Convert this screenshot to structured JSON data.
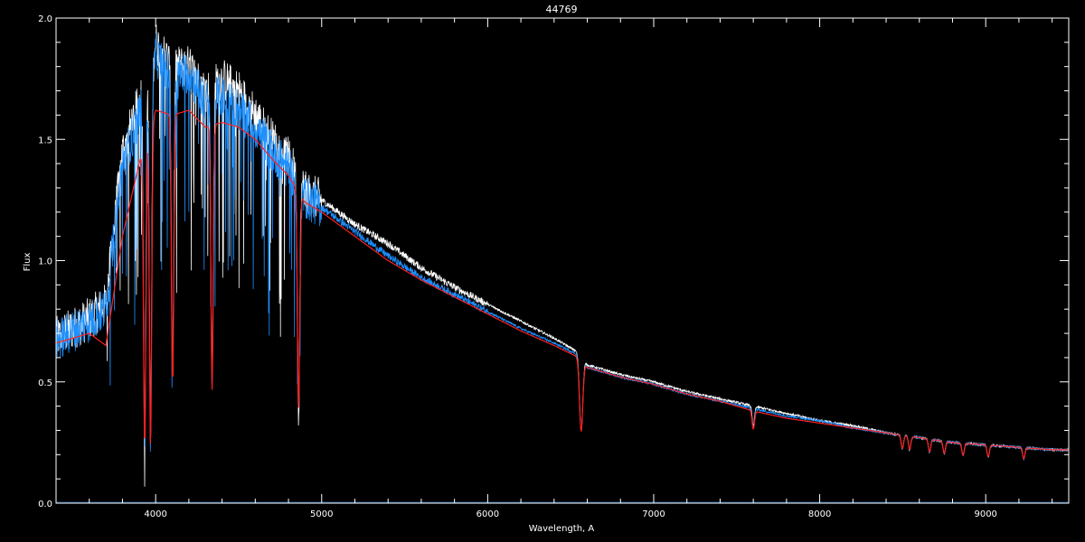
{
  "chart_data": {
    "type": "line",
    "title": "44769",
    "xlabel": "Wavelength, A",
    "ylabel": "Flux",
    "xlim": [
      3400,
      9500
    ],
    "ylim": [
      0.0,
      2.0
    ],
    "x_ticks": [
      4000,
      5000,
      6000,
      7000,
      8000,
      9000
    ],
    "x_tick_labels": [
      "4000",
      "5000",
      "6000",
      "7000",
      "8000",
      "9000"
    ],
    "y_ticks": [
      0.0,
      0.5,
      1.0,
      1.5,
      2.0
    ],
    "y_tick_labels": [
      "0.0",
      "0.5",
      "1.0",
      "1.5",
      "2.0"
    ],
    "grid": false,
    "colors": {
      "background": "#000000",
      "axes": "#ffffff",
      "observed": "#ffffff",
      "model": "#1e90ff",
      "fit": "#ff2020"
    },
    "series": [
      {
        "key": "observed",
        "color": "#ffffff",
        "x": [
          3400,
          3600,
          3700,
          3800,
          3900,
          4000,
          4100,
          4200,
          4300,
          4400,
          4500,
          4600,
          4700,
          4800,
          4900,
          5000,
          5200,
          5400,
          5600,
          5800,
          6000,
          6200,
          6400,
          6550,
          6600,
          6800,
          7000,
          7200,
          7400,
          7600,
          7800,
          8000,
          8200,
          8400,
          8600,
          8800,
          9000,
          9200,
          9400,
          9500
        ],
        "y": [
          0.68,
          0.76,
          0.82,
          1.45,
          1.65,
          1.9,
          1.8,
          1.8,
          1.7,
          1.75,
          1.7,
          1.6,
          1.5,
          1.42,
          1.28,
          1.25,
          1.15,
          1.07,
          0.97,
          0.89,
          0.82,
          0.75,
          0.68,
          0.62,
          0.57,
          0.53,
          0.5,
          0.46,
          0.43,
          0.4,
          0.37,
          0.34,
          0.32,
          0.29,
          0.27,
          0.25,
          0.24,
          0.23,
          0.22,
          0.22
        ]
      },
      {
        "key": "model",
        "color": "#1e90ff",
        "x": [
          3400,
          3600,
          3700,
          3800,
          3900,
          4000,
          4100,
          4200,
          4300,
          4400,
          4500,
          4600,
          4700,
          4800,
          4900,
          5000,
          5200,
          5400,
          5600,
          5800,
          6000,
          6200,
          6400,
          6550,
          6600,
          6800,
          7000,
          7200,
          7400,
          7600,
          7800,
          8000,
          8200,
          8400,
          8600,
          8800,
          9000,
          9200,
          9400,
          9500
        ],
        "y": [
          0.67,
          0.75,
          0.8,
          1.4,
          1.6,
          1.85,
          1.75,
          1.78,
          1.65,
          1.68,
          1.62,
          1.55,
          1.45,
          1.38,
          1.26,
          1.22,
          1.12,
          1.02,
          0.93,
          0.86,
          0.79,
          0.72,
          0.66,
          0.61,
          0.56,
          0.52,
          0.49,
          0.45,
          0.42,
          0.39,
          0.36,
          0.34,
          0.31,
          0.29,
          0.27,
          0.25,
          0.24,
          0.23,
          0.22,
          0.22
        ]
      },
      {
        "key": "fit",
        "color": "#ff2020",
        "x": [
          3400,
          3600,
          3700,
          3800,
          3900,
          4000,
          4100,
          4200,
          4300,
          4400,
          4500,
          4600,
          4700,
          4800,
          4900,
          5000,
          5200,
          5400,
          5600,
          5800,
          6000,
          6200,
          6400,
          6550,
          6600,
          6800,
          7000,
          7200,
          7400,
          7600,
          7800,
          8000,
          8200,
          8400,
          8600,
          8800,
          9000,
          9200,
          9400,
          9500
        ],
        "y": [
          0.66,
          0.7,
          0.65,
          1.1,
          1.4,
          1.62,
          1.6,
          1.62,
          1.55,
          1.57,
          1.55,
          1.5,
          1.42,
          1.35,
          1.24,
          1.2,
          1.1,
          1.0,
          0.92,
          0.85,
          0.78,
          0.71,
          0.65,
          0.6,
          0.56,
          0.52,
          0.49,
          0.45,
          0.42,
          0.38,
          0.35,
          0.33,
          0.31,
          0.29,
          0.27,
          0.25,
          0.24,
          0.23,
          0.22,
          0.22
        ]
      }
    ],
    "absorption_lines_x": [
      3934,
      3969,
      4102,
      4340,
      4861,
      6563,
      7600,
      8498,
      8542,
      8662,
      8750,
      8863,
      9015,
      9229
    ]
  }
}
